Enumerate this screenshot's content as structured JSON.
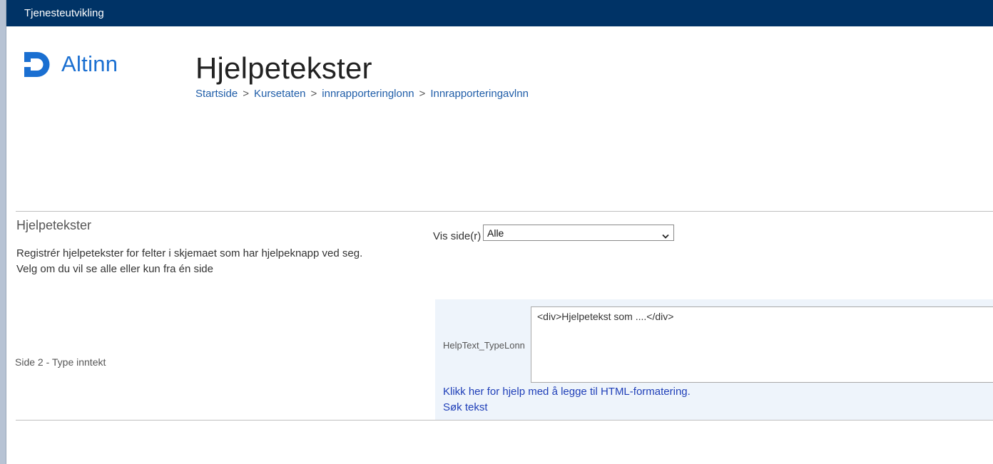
{
  "topbar": {
    "title": "Tjenesteutvikling"
  },
  "logo": {
    "text": "Altinn",
    "color": "#1a6fd1"
  },
  "page": {
    "title": "Hjelpetekster"
  },
  "breadcrumb": {
    "items": [
      "Startside",
      "Kursetaten",
      "innrapporteringlonn",
      "Innrapporteringavlnn"
    ],
    "separator": ">"
  },
  "section": {
    "heading": "Hjelpetekster",
    "description_line1": "Registrér hjelpetekster for felter i skjemaet som har hjelpeknapp ved seg.",
    "description_line2": "Velg om du vil se alle eller kun fra én side"
  },
  "filter": {
    "label": "Vis side(r)",
    "selected": "Alle"
  },
  "helptext_row": {
    "side_label": "Side 2 - Type inntekt",
    "field_label": "HelpText_TypeLonn",
    "value": "<div>Hjelpetekst som ....</div>",
    "help_link": "Klikk her for hjelp med å legge til HTML-formatering.",
    "search_link": "Søk tekst"
  },
  "colors": {
    "topbar": "#003366",
    "link": "#1f5da8",
    "panel_bg": "#eef4fb"
  }
}
